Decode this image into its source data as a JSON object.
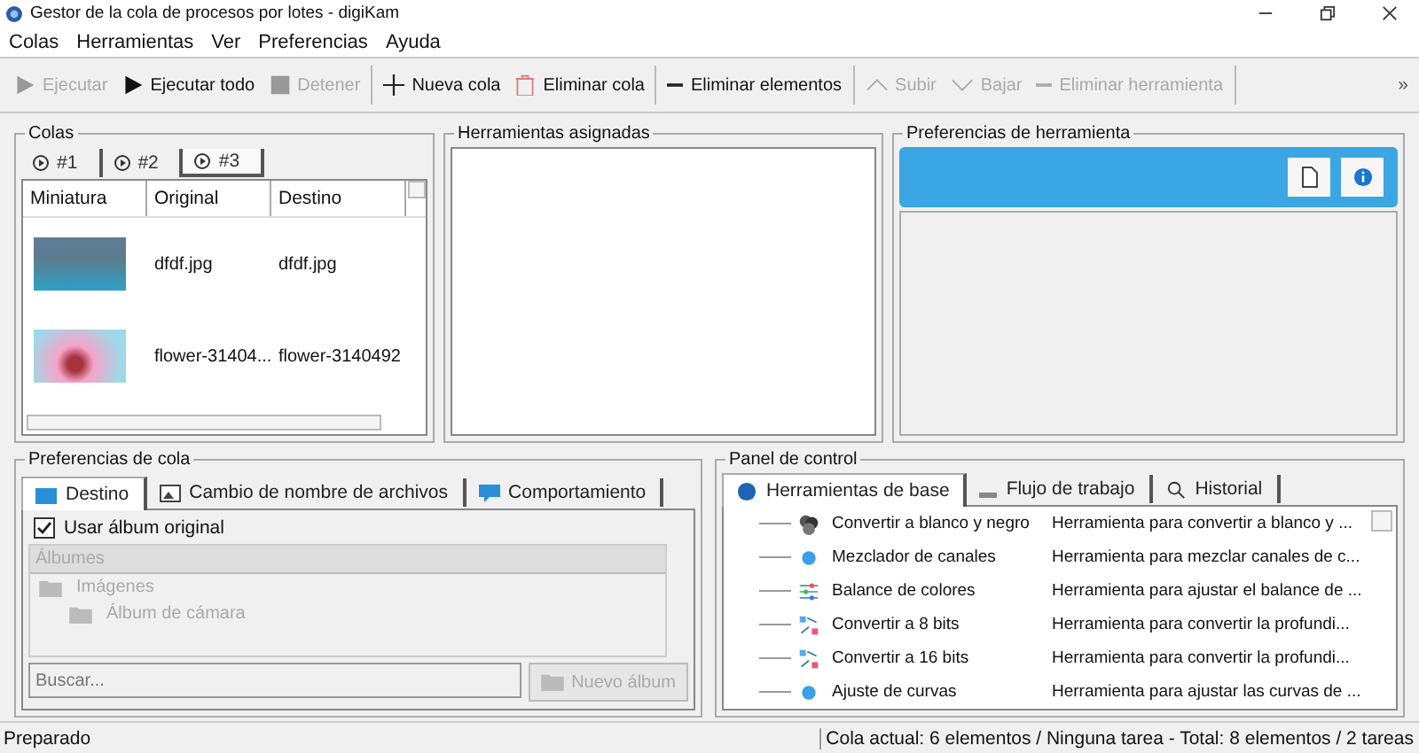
{
  "window": {
    "title": "Gestor de la cola de procesos por lotes - digiKam"
  },
  "menu": [
    "Colas",
    "Herramientas",
    "Ver",
    "Preferencias",
    "Ayuda"
  ],
  "toolbar": [
    {
      "label": "Ejecutar",
      "disabled": true
    },
    {
      "label": "Ejecutar todo",
      "disabled": false
    },
    {
      "label": "Detener",
      "disabled": true
    },
    {
      "label": "Nueva cola",
      "disabled": false
    },
    {
      "label": "Eliminar cola",
      "disabled": false
    },
    {
      "label": "Eliminar elementos",
      "disabled": false
    },
    {
      "label": "Subir",
      "disabled": true
    },
    {
      "label": "Bajar",
      "disabled": true
    },
    {
      "label": "Eliminar herramienta",
      "disabled": true
    }
  ],
  "toolbar_overflow": "»",
  "queues": {
    "title": "Colas",
    "tabs": [
      {
        "label": "#1",
        "selected": false
      },
      {
        "label": "#2",
        "selected": false
      },
      {
        "label": "#3",
        "selected": true
      }
    ],
    "columns": [
      "Miniatura",
      "Original",
      "Destino"
    ],
    "rows": [
      {
        "original": "dfdf.jpg",
        "destino": "dfdf.jpg"
      },
      {
        "original": "flower-31404...",
        "destino": "flower-3140492"
      }
    ]
  },
  "assigned_tools": {
    "title": "Herramientas asignadas"
  },
  "tool_settings": {
    "title": "Preferencias de herramienta"
  },
  "queue_settings": {
    "title": "Preferencias de cola",
    "tabs": [
      {
        "label": "Destino",
        "selected": true
      },
      {
        "label": "Cambio de nombre de archivos",
        "selected": false
      },
      {
        "label": "Comportamiento",
        "selected": false
      }
    ],
    "use_original_album": {
      "label": "Usar álbum original",
      "checked": true
    },
    "albums_header": "Álbumes",
    "albums": [
      {
        "label": "Imágenes",
        "children": [
          {
            "label": "Álbum de cámara"
          }
        ]
      }
    ],
    "search": {
      "placeholder": "Buscar..."
    },
    "new_album": {
      "label": "Nuevo álbum",
      "disabled": true
    }
  },
  "control_panel": {
    "title": "Panel de control",
    "tabs": [
      {
        "label": "Herramientas de base",
        "selected": true
      },
      {
        "label": "Flujo de trabajo",
        "selected": false
      },
      {
        "label": "Historial",
        "selected": false
      }
    ],
    "tools": [
      {
        "name": "Convertir a blanco y negro",
        "description": "Herramienta para convertir a blanco y ..."
      },
      {
        "name": "Mezclador de canales",
        "description": "Herramienta para mezclar canales de c..."
      },
      {
        "name": "Balance de colores",
        "description": "Herramienta para ajustar el balance de ..."
      },
      {
        "name": "Convertir a 8 bits",
        "description": "Herramienta para convertir la profundi..."
      },
      {
        "name": "Convertir a 16 bits",
        "description": "Herramienta para convertir la profundi..."
      },
      {
        "name": "Ajuste de curvas",
        "description": "Herramienta para ajustar las curvas de ..."
      }
    ]
  },
  "status_bar": {
    "left": "Preparado",
    "right": "Cola actual: 6 elementos / Ninguna tarea - Total: 8 elementos / 2 tareas"
  }
}
